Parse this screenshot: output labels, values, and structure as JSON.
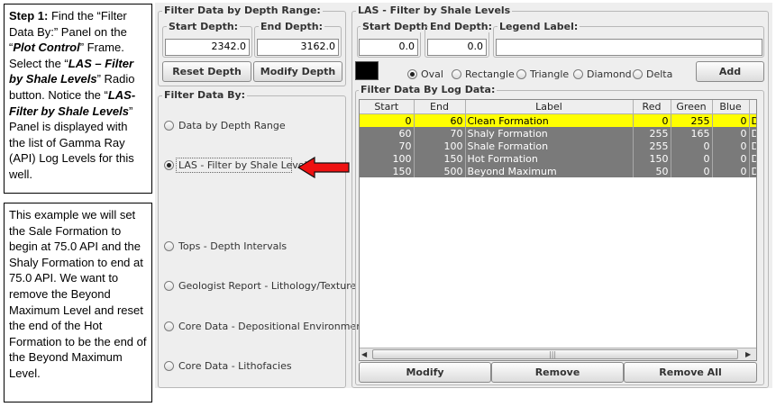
{
  "notes": {
    "step1": {
      "prefix": "Step 1:",
      "p1": " Find the “Filter Data  By:” Panel  on the “",
      "plot_control": "Plot Control",
      "p2": "” Frame. Select the “",
      "las_filter": "LAS – Filter by Shale Levels",
      "p3": "” Radio button. Notice the “",
      "las_panel": "LAS-Filter by Shale Levels",
      "p4": "”  Panel is displayed with the list of Gamma Ray (API) Log Levels for this well."
    },
    "example": "This example we will set the Sale Formation to begin at 75.0  API and the Shaly Formation to end at 75.0 API.  We want to remove the Beyond Maximum Level and reset the  end of the Hot Formation to be the end of the Beyond Maximum Level."
  },
  "depth_range": {
    "title": "Filter Data by Depth Range:",
    "start_label": "Start Depth:",
    "start_value": "2342.0",
    "end_label": "End Depth:",
    "end_value": "3162.0",
    "reset_label": "Reset Depth",
    "modify_label": "Modify Depth"
  },
  "filter_by": {
    "title": "Filter Data By:",
    "options": [
      {
        "label": "Data by Depth Range",
        "selected": false
      },
      {
        "label": "LAS - Filter by Shale Levels",
        "selected": true
      },
      {
        "label": "Tops - Depth Intervals",
        "selected": false
      },
      {
        "label": "Geologist Report - Lithology/Texture",
        "selected": false
      },
      {
        "label": "Core Data - Depositional Environment",
        "selected": false
      },
      {
        "label": "Core Data - Lithofacies",
        "selected": false
      }
    ]
  },
  "shale": {
    "title": "LAS - Filter by Shale Levels",
    "start_label": "Start Depth:",
    "start_value": "0.0",
    "end_label": "End Depth:",
    "end_value": "0.0",
    "legend_label": "Legend Label:",
    "legend_value": "",
    "swatch_color": "#000000",
    "shapes": [
      {
        "label": "Oval",
        "selected": true
      },
      {
        "label": "Rectangle",
        "selected": false
      },
      {
        "label": "Triangle",
        "selected": false
      },
      {
        "label": "Diamond",
        "selected": false
      },
      {
        "label": "Delta",
        "selected": false
      }
    ],
    "add_label": "Add",
    "log_title": "Filter Data By Log Data:",
    "columns": [
      "Start",
      "End",
      "Label",
      "Red",
      "Green",
      "Blue",
      ""
    ],
    "rows": [
      {
        "start": "0",
        "end": "60",
        "label": "Clean Formation",
        "red": "0",
        "green": "255",
        "blue": "0",
        "extra": "D",
        "selected": true
      },
      {
        "start": "60",
        "end": "70",
        "label": "Shaly Formation",
        "red": "255",
        "green": "165",
        "blue": "0",
        "extra": "D",
        "selected": false
      },
      {
        "start": "70",
        "end": "100",
        "label": "Shale Formation",
        "red": "255",
        "green": "0",
        "blue": "0",
        "extra": "D",
        "selected": false
      },
      {
        "start": "100",
        "end": "150",
        "label": "Hot Formation",
        "red": "150",
        "green": "0",
        "blue": "0",
        "extra": "D",
        "selected": false
      },
      {
        "start": "150",
        "end": "500",
        "label": "Beyond Maximum",
        "red": "50",
        "green": "0",
        "blue": "0",
        "extra": "D",
        "selected": false
      }
    ],
    "modify_label": "Modify",
    "remove_label": "Remove",
    "remove_all_label": "Remove All",
    "scroll_left": "◀",
    "scroll_right": "▶",
    "scroll_grip": "|||"
  },
  "colors": {
    "selected_row": "#ffff00",
    "data_row": "#7a7a7a",
    "arrow_fill": "#ee1111"
  }
}
